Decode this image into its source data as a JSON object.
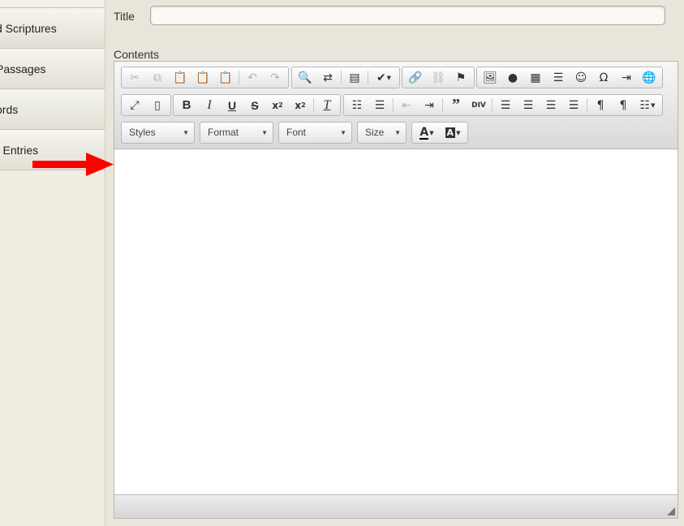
{
  "sidebar": {
    "items": [
      {
        "label": "d Scriptures"
      },
      {
        "label": "Passages"
      },
      {
        "label": "ords"
      },
      {
        "label": "r Entries"
      }
    ]
  },
  "form": {
    "title_label": "Title",
    "title_value": "",
    "contents_label": "Contents"
  },
  "toolbar": {
    "styles": "Styles",
    "format": "Format",
    "font": "Font",
    "size": "Size"
  },
  "editor": {
    "content": ""
  },
  "colors": {
    "arrow": "#ff0000",
    "background": "#e8e6da"
  }
}
